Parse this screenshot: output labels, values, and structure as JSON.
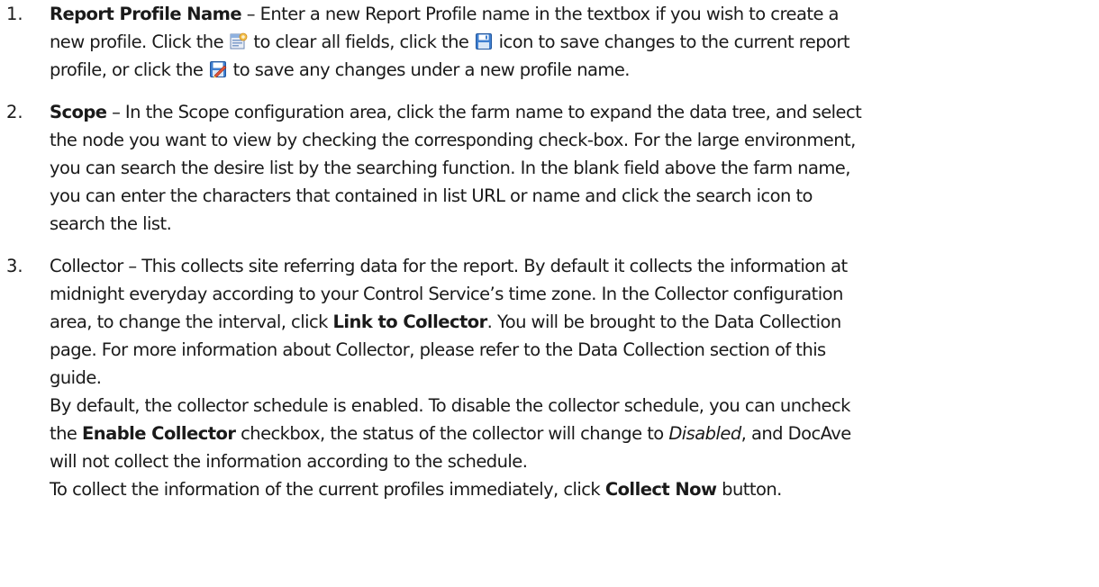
{
  "items": [
    {
      "number": "1.",
      "line1": {
        "bold": "Report Profile Name",
        "text": " – Enter a new Report Profile name in the textbox if you wish to create a"
      },
      "line2": {
        "a": "new profile. Click the ",
        "b": " to clear all fields, click the ",
        "c": " icon to save changes to the current report"
      },
      "line3": {
        "a": "profile, or click the ",
        "b": " to save any changes under a new profile name."
      }
    },
    {
      "number": "2.",
      "line1": {
        "bold": "Scope",
        "text": " – In the Scope configuration area, click the farm name to expand the data tree, and select"
      },
      "line2": "the node you want to view by checking the corresponding check-box. For the large environment,",
      "line3": "you can search the desire list by the searching function. In the blank field above the farm name,",
      "line4": "you can enter the characters that contained in list URL or name and click the search icon to",
      "line5": "search the list."
    },
    {
      "number": "3.",
      "line1": "Collector – This collects site referring data for the report. By default it collects the information at",
      "line2": "midnight everyday according to your Control Service’s time zone. In the Collector configuration",
      "line3": {
        "a": "area, to change the interval, click ",
        "bold": "Link to Collector",
        "b": ". You will be brought to the Data Collection"
      },
      "line4": "page. For more information about Collector, please refer to the Data Collection section of this",
      "line5": "guide.",
      "line6": "By default, the collector schedule is enabled. To disable the collector schedule, you can uncheck",
      "line7": {
        "a": "the ",
        "bold": "Enable Collector",
        "b": " checkbox, the status of the collector will change to ",
        "italic": "Disabled",
        "c": ", and DocAve"
      },
      "line8": "will not collect the information according to the schedule.",
      "line9": {
        "a": "To collect the information of the current profiles immediately, click ",
        "bold": "Collect Now",
        "b": " button."
      }
    }
  ],
  "icons": {
    "clear": "clear-fields-icon",
    "save": "save-icon",
    "save_as": "save-as-icon"
  }
}
